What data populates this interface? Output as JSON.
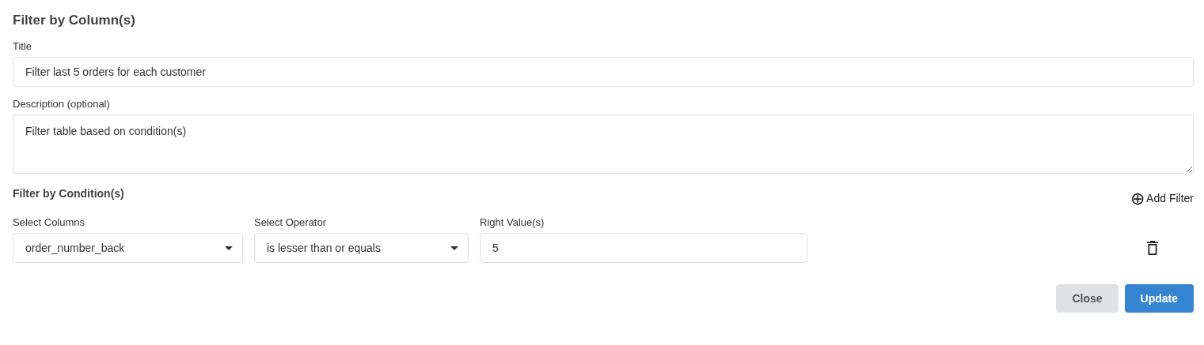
{
  "heading": "Filter by Column(s)",
  "title_field": {
    "label": "Title",
    "value": "Filter last 5 orders for each customer"
  },
  "description_field": {
    "label": "Description (optional)",
    "value": "Filter table based on condition(s)"
  },
  "conditions_heading": "Filter by Condition(s)",
  "add_filter": {
    "icon": "⊕",
    "label": "Add Filter"
  },
  "conditions": [
    {
      "column_label": "Select Columns",
      "column": "order_number_back",
      "operator_label": "Select Operator",
      "operator": "is lesser than or equals",
      "value_label": "Right Value(s)",
      "value": "5"
    }
  ],
  "buttons": [
    {
      "kind": "secondary",
      "label": "Close"
    },
    {
      "kind": "primary",
      "label": "Update"
    }
  ]
}
